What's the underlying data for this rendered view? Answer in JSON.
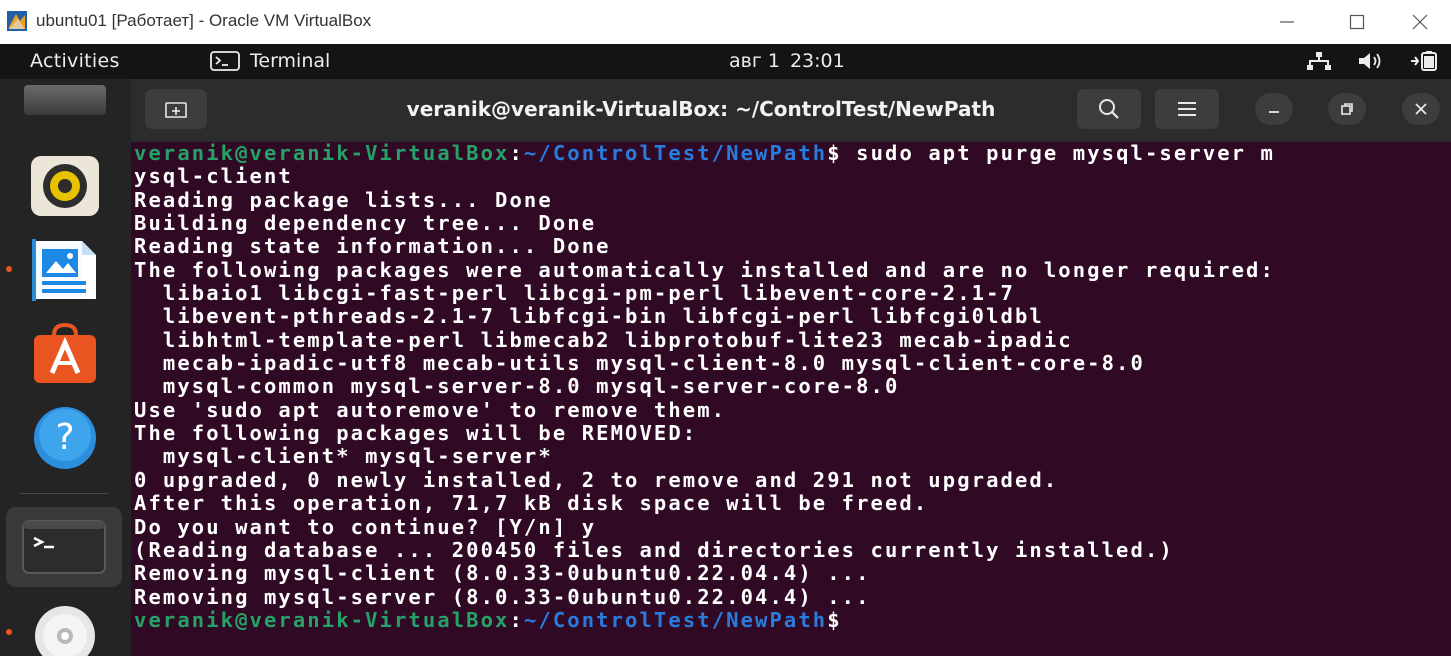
{
  "vbox_window": {
    "title": "ubuntu01 [Работает] - Oracle VM VirtualBox",
    "logo_icon": "virtualbox-logo-icon",
    "controls": [
      "minimize-icon",
      "maximize-icon",
      "close-icon"
    ]
  },
  "gnome_topbar": {
    "activities": "Activities",
    "app_name": "Terminal",
    "date": "авг 1",
    "time": "23:01",
    "tray_icons": [
      "network-icon",
      "volume-icon",
      "power-icon"
    ]
  },
  "dock": {
    "items": [
      {
        "name": "dock-item-unknown",
        "icon": "app-icon",
        "running": false
      },
      {
        "name": "dock-item-rhythmbox",
        "icon": "rhythmbox-icon",
        "running": false
      },
      {
        "name": "dock-item-writer",
        "icon": "libreoffice-writer-icon",
        "running": true
      },
      {
        "name": "dock-item-software",
        "icon": "ubuntu-software-icon",
        "running": false
      },
      {
        "name": "dock-item-help",
        "icon": "help-icon",
        "running": false
      },
      {
        "name": "dock-item-terminal",
        "icon": "terminal-icon",
        "running": true,
        "active": true
      },
      {
        "name": "dock-item-disc",
        "icon": "disc-icon",
        "running": true
      }
    ]
  },
  "terminal": {
    "title": "veranik@veranik-VirtualBox: ~/ControlTest/NewPath",
    "header_icons": [
      "new-tab-icon",
      "search-icon",
      "hamburger-menu-icon",
      "minimize-icon",
      "restore-icon",
      "close-icon"
    ],
    "colors": {
      "background": "#300a24",
      "prompt_user": "#26a269",
      "prompt_path": "#2a7bde",
      "text": "#ffffff"
    },
    "prompt_user": "veranik@veranik-VirtualBox",
    "prompt_sep": ":",
    "prompt_path": "~/ControlTest/NewPath",
    "prompt_dollar": "$",
    "command": " sudo apt purge mysql-server m",
    "output_lines": [
      "ysql-client",
      "Reading package lists... Done",
      "Building dependency tree... Done",
      "Reading state information... Done",
      "The following packages were automatically installed and are no longer required:",
      "  libaio1 libcgi-fast-perl libcgi-pm-perl libevent-core-2.1-7",
      "  libevent-pthreads-2.1-7 libfcgi-bin libfcgi-perl libfcgi0ldbl",
      "  libhtml-template-perl libmecab2 libprotobuf-lite23 mecab-ipadic",
      "  mecab-ipadic-utf8 mecab-utils mysql-client-8.0 mysql-client-core-8.0",
      "  mysql-common mysql-server-8.0 mysql-server-core-8.0",
      "Use 'sudo apt autoremove' to remove them.",
      "The following packages will be REMOVED:",
      "  mysql-client* mysql-server*",
      "0 upgraded, 0 newly installed, 2 to remove and 291 not upgraded.",
      "After this operation, 71,7 kB disk space will be freed.",
      "Do you want to continue? [Y/n] y",
      "(Reading database ... 200450 files and directories currently installed.)",
      "Removing mysql-client (8.0.33-0ubuntu0.22.04.4) ...",
      "Removing mysql-server (8.0.33-0ubuntu0.22.04.4) ..."
    ]
  }
}
